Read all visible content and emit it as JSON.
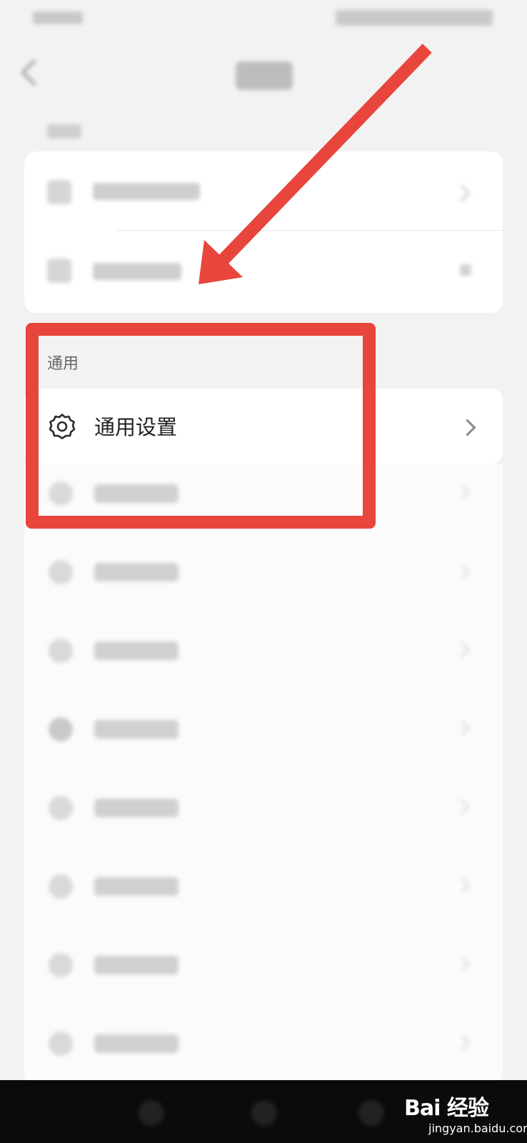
{
  "general_section": {
    "header": "通用",
    "item_label": "通用设置",
    "item_icon": "gear-icon"
  },
  "watermark": {
    "text": "Bai 经验",
    "subtext": "jingyan.baidu.com"
  },
  "colors": {
    "annotation_red": "#e8453c",
    "background": "#f2f2f2",
    "card": "#ffffff"
  }
}
